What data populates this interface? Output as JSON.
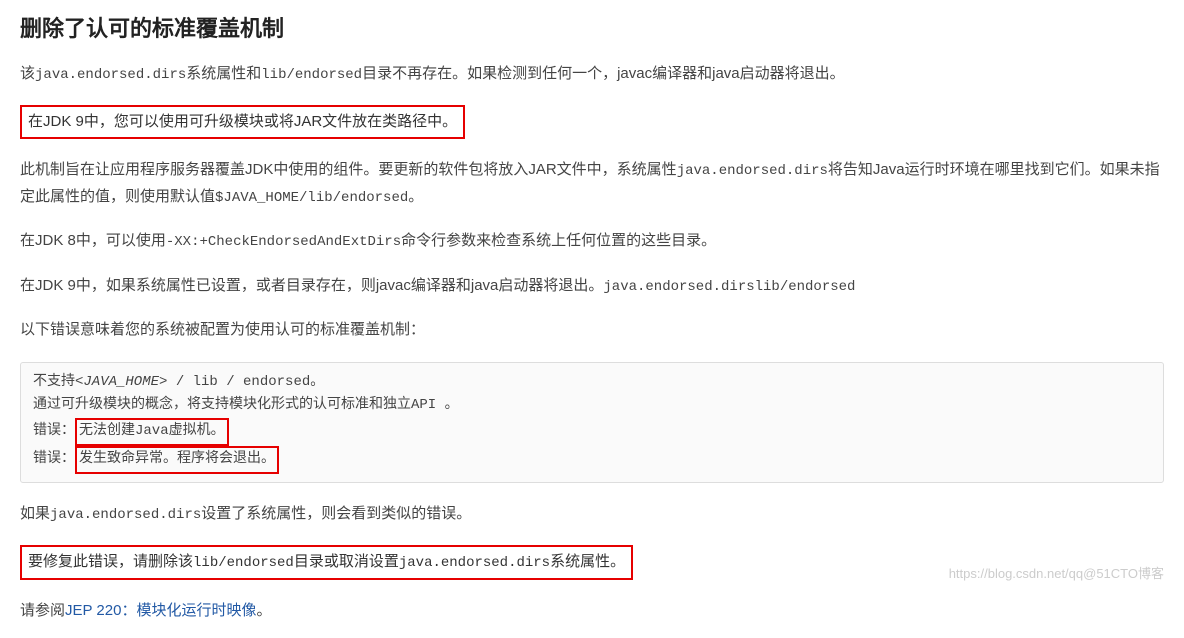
{
  "heading": "删除了认可的标准覆盖机制",
  "p1_a": "该",
  "p1_code1": "java.endorsed.dirs",
  "p1_b": "系统属性和",
  "p1_code2": "lib/endorsed",
  "p1_c": "目录不再存在。如果检测到任何一个，javac编译器和java启动器将退出。",
  "boxed1": "在JDK 9中，您可以使用可升级模块或将JAR文件放在类路径中。",
  "p2_a": "此机制旨在让应用程序服务器覆盖JDK中使用的组件。要更新的软件包将放入JAR文件中，系统属性",
  "p2_code1": "java.endorsed.dirs",
  "p2_b": "将告知Java运行时环境在哪里找到它们。如果未指定此属性的值，则使用默认值",
  "p2_code2": "$JAVA_HOME/lib/endorsed",
  "p2_c": "。",
  "p3_a": "在JDK 8中，可以使用",
  "p3_code1": "-XX:+CheckEndorsedAndExtDirs",
  "p3_b": "命令行参数来检查系统上任何位置的这些目录。",
  "p4_a": "在JDK 9中，如果系统属性已设置，或者目录存在，则javac编译器和java启动器将退出。",
  "p4_code1": "java.endorsed.dirslib/endorsed",
  "p5": "以下错误意味着您的系统被配置为使用认可的标准覆盖机制：",
  "code_line1_a": "不支持",
  "code_line1_b": "<JAVA_HOME>",
  "code_line1_c": " / lib / endorsed。",
  "code_line2": "通过可升级模块的概念，将支持模块化形式的认可标准和独立API 。",
  "code_line3_a": "错误：",
  "code_line3_b": "无法创建Java虚拟机。",
  "code_line4_a": "错误：",
  "code_line4_b": "发生致命异常。程序将会退出。",
  "p6_a": "如果",
  "p6_code1": "java.endorsed.dirs",
  "p6_b": "设置了系统属性，则会看到类似的错误。",
  "boxed2_a": "要修复此错误，请删除该",
  "boxed2_code1": "lib/endorsed",
  "boxed2_b": "目录或取消设置",
  "boxed2_code2": "java.endorsed.dirs",
  "boxed2_c": "系统属性。",
  "p7_a": "请参阅",
  "p7_link": "JEP 220：模块化运行时映像",
  "p7_b": "。",
  "watermark": "https://blog.csdn.net/qq@51CTO博客"
}
